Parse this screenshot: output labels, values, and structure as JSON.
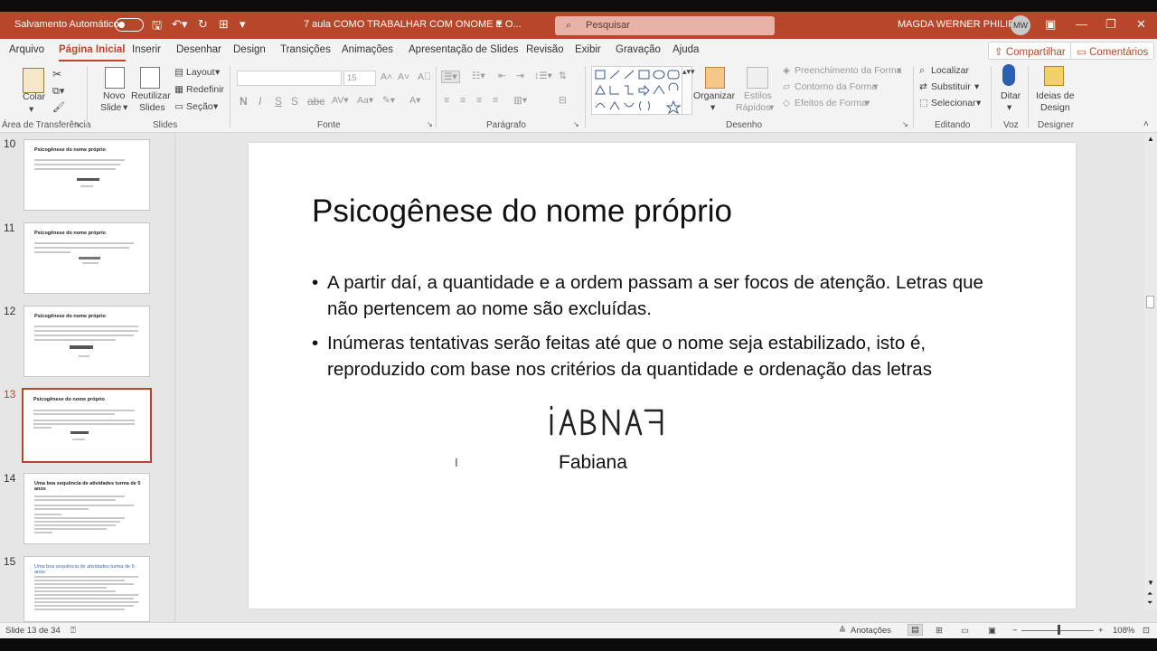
{
  "titlebar": {
    "autosave_label": "Salvamento Automático",
    "doc_title": "7 aula COMO TRABALHAR COM ONOME E O...",
    "search_placeholder": "Pesquisar",
    "user_name": "MAGDA WERNER PHILIPPI",
    "user_initials": "MW"
  },
  "menu": {
    "items": [
      "Arquivo",
      "Página Inicial",
      "Inserir",
      "Desenhar",
      "Design",
      "Transições",
      "Animações",
      "Apresentação de Slides",
      "Revisão",
      "Exibir",
      "Gravação",
      "Ajuda"
    ],
    "active": "Página Inicial",
    "share": "Compartilhar",
    "comments": "Comentários"
  },
  "ribbon": {
    "clipboard": {
      "paste": "Colar",
      "group": "Área de Transferência"
    },
    "slides": {
      "new_slide_1": "Novo",
      "new_slide_2": "Slide",
      "reuse_1": "Reutilizar",
      "reuse_2": "Slides",
      "layout": "Layout",
      "reset": "Redefinir",
      "section": "Seção",
      "group": "Slides"
    },
    "font": {
      "font_size": "15",
      "group": "Fonte"
    },
    "paragraph": {
      "group": "Parágrafo"
    },
    "drawing": {
      "arrange": "Organizar",
      "styles_1": "Estilos",
      "styles_2": "Rápidos",
      "fill": "Preenchimento da Forma",
      "outline": "Contorno da Forma",
      "effects": "Efeitos de Forma",
      "group": "Desenho"
    },
    "editing": {
      "find": "Localizar",
      "replace": "Substituir",
      "select": "Selecionar",
      "group": "Editando"
    },
    "voice": {
      "dictate": "Ditar",
      "group": "Voz"
    },
    "designer": {
      "ideas_1": "Ideias de",
      "ideas_2": "Design",
      "group": "Designer"
    }
  },
  "thumbnails": [
    {
      "number": "10",
      "title": "Psicogênese do nome próprio",
      "selected": false
    },
    {
      "number": "11",
      "title": "Psicogênese do nome próprio",
      "selected": false
    },
    {
      "number": "12",
      "title": "Psicogênese do nome próprio",
      "selected": false
    },
    {
      "number": "13",
      "title": "Psicogênese do nome próprio",
      "selected": true
    },
    {
      "number": "14",
      "title": "Uma boa sequência de atividades turma de 5 anos",
      "selected": false
    },
    {
      "number": "15",
      "title": "Uma boa sequência de atividades turma de 5 anos",
      "selected": false
    }
  ],
  "slide": {
    "title": "Psicogênese do nome próprio",
    "bullets": [
      "A partir daí, a quantidade e a ordem passam a ser focos de atenção. Letras que não pertencem ao nome são excluídas.",
      "Inúmeras tentativas serão feitas até que o nome seja estabilizado, isto é, reproduzido com base nos critérios da quantidade e ordenação das letras"
    ],
    "handwriting": "ꟻABИAI",
    "caption": "Fabiana"
  },
  "status": {
    "slide_info": "Slide 13 de 34",
    "notes": "Anotações",
    "zoom": "108%"
  }
}
